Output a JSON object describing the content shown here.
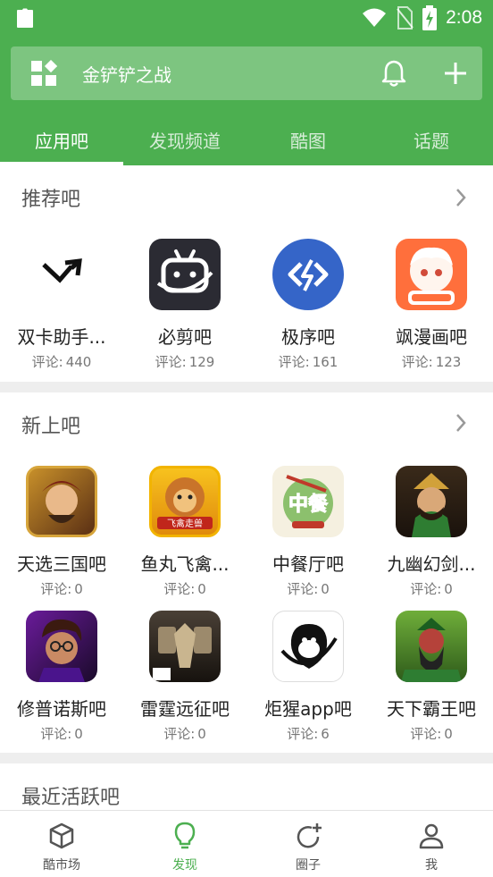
{
  "status_bar": {
    "time": "2:08"
  },
  "search": {
    "title": "金铲铲之战"
  },
  "tabs": [
    {
      "label": "应用吧",
      "active": true
    },
    {
      "label": "发现频道",
      "active": false
    },
    {
      "label": "酷图",
      "active": false
    },
    {
      "label": "话题",
      "active": false
    }
  ],
  "comment_prefix": "评论:",
  "sections": {
    "recommended": {
      "title": "推荐吧",
      "items": [
        {
          "name": "双卡助手...",
          "comments": "440",
          "icon": "dual-sim-icon"
        },
        {
          "name": "必剪吧",
          "comments": "129",
          "icon": "bicut-app-icon"
        },
        {
          "name": "极序吧",
          "comments": "161",
          "icon": "jixu-app-icon"
        },
        {
          "name": "飒漫画吧",
          "comments": "123",
          "icon": "saman-app-icon"
        }
      ]
    },
    "new": {
      "title": "新上吧",
      "items": [
        {
          "name": "天选三国吧",
          "comments": "0",
          "icon": "game-icon"
        },
        {
          "name": "鱼丸飞禽...",
          "comments": "0",
          "icon": "game-icon"
        },
        {
          "name": "中餐厅吧",
          "comments": "0",
          "icon": "game-icon"
        },
        {
          "name": "九幽幻剑...",
          "comments": "0",
          "icon": "game-icon"
        },
        {
          "name": "修普诺斯吧",
          "comments": "0",
          "icon": "game-icon"
        },
        {
          "name": "雷霆远征吧",
          "comments": "0",
          "icon": "game-icon"
        },
        {
          "name": "炬猩app吧",
          "comments": "6",
          "icon": "gorilla-app-icon"
        },
        {
          "name": "天下霸王吧",
          "comments": "0",
          "icon": "game-icon"
        }
      ],
      "icon_labels": {
        "yuwan": "飞禽走兽",
        "canting": "中餐"
      }
    },
    "active": {
      "title": "最近活跃吧"
    }
  },
  "bottom_nav": [
    {
      "label": "酷市场",
      "icon": "cube-icon",
      "active": false
    },
    {
      "label": "发现",
      "icon": "lightbulb-icon",
      "active": true
    },
    {
      "label": "圈子",
      "icon": "circle-plus-icon",
      "active": false
    },
    {
      "label": "我",
      "icon": "person-icon",
      "active": false
    }
  ],
  "colors": {
    "primary": "#4caf50",
    "accent_blue": "#2f5fc4",
    "accent_orange": "#ff7043"
  }
}
